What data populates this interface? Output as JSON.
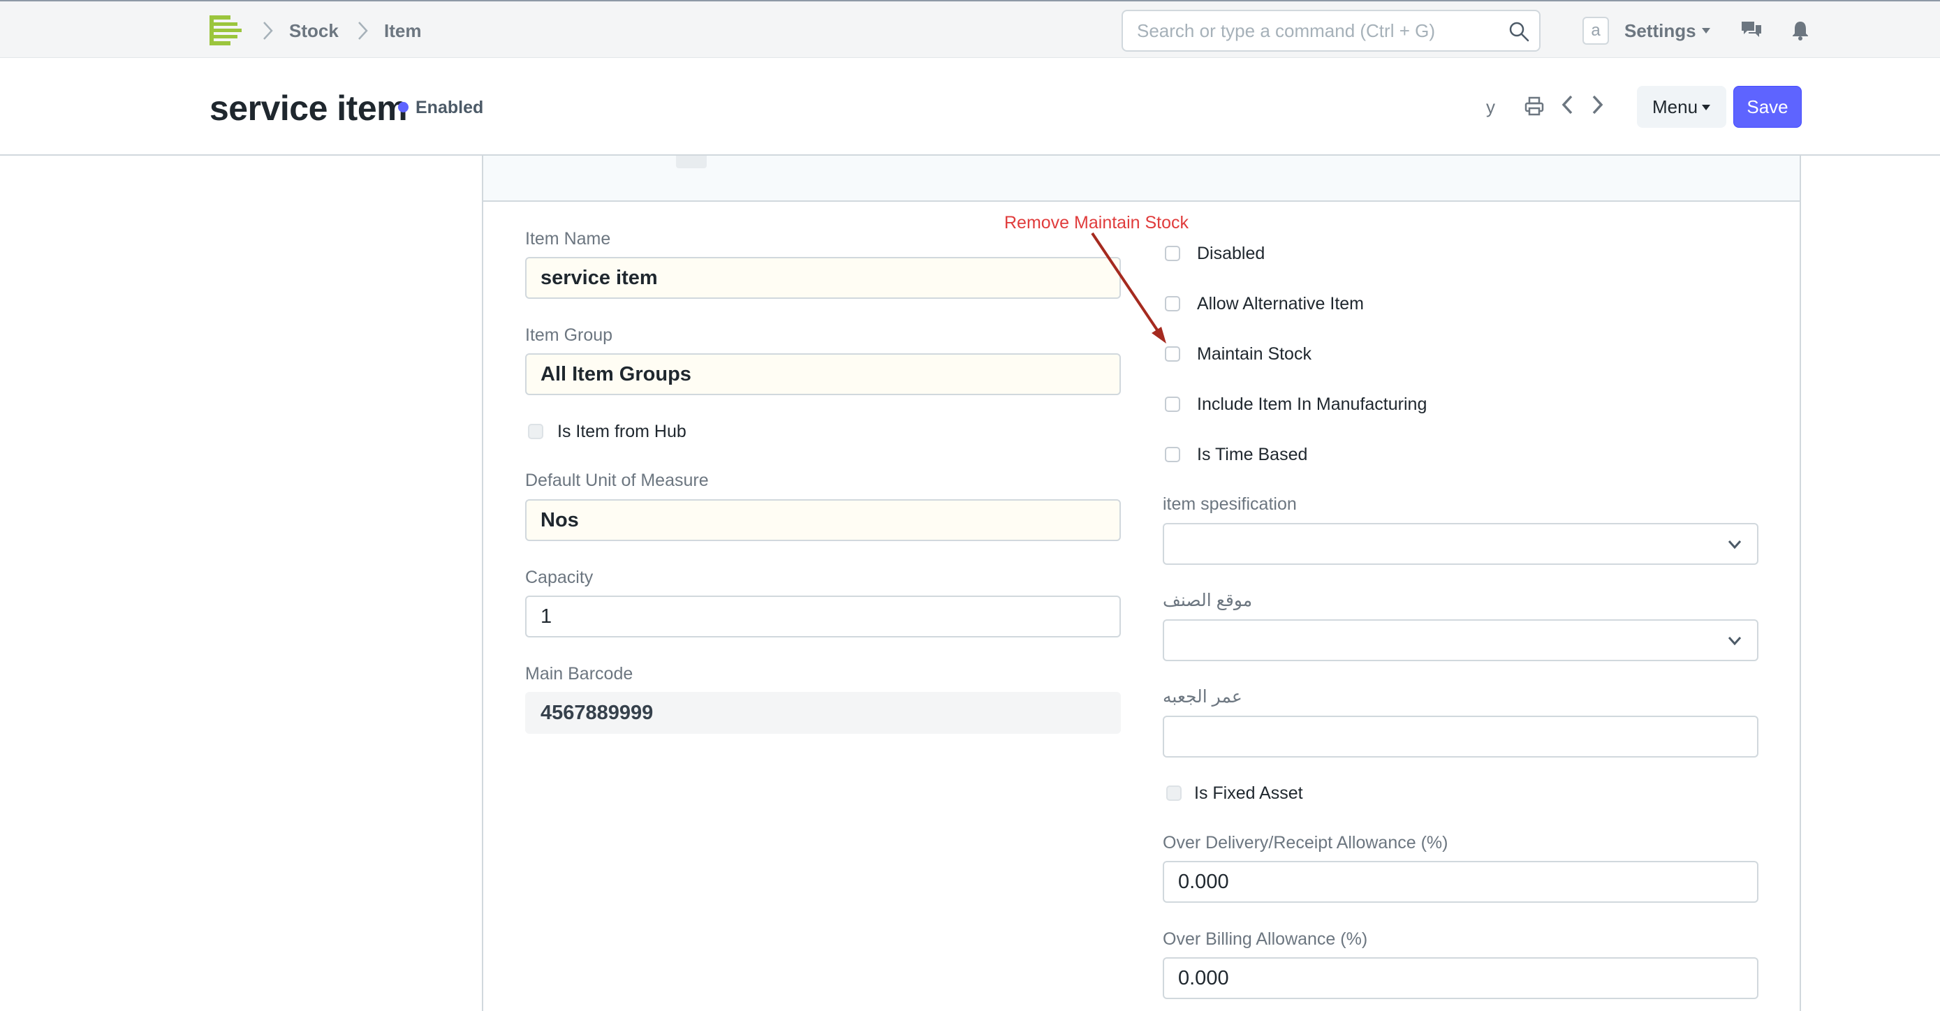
{
  "navbar": {
    "breadcrumbs": [
      "Stock",
      "Item"
    ],
    "search_placeholder": "Search or type a command (Ctrl + G)",
    "avatar_letter": "a",
    "settings_label": "Settings"
  },
  "page_head": {
    "title": "service item",
    "status": "Enabled",
    "extra_text": "y",
    "menu_label": "Menu",
    "save_label": "Save",
    "accent_color": "#5e64ff"
  },
  "annotation": {
    "text": "Remove Maintain Stock",
    "color": "#e03c3c"
  },
  "left_fields": {
    "item_name": {
      "label": "Item Name",
      "value": "service item"
    },
    "item_group": {
      "label": "Item Group",
      "value": "All Item Groups"
    },
    "is_item_from_hub": {
      "label": "Is Item from Hub",
      "checked": false
    },
    "default_uom": {
      "label": "Default Unit of Measure",
      "value": "Nos"
    },
    "capacity": {
      "label": "Capacity",
      "value": "1"
    },
    "main_barcode": {
      "label": "Main Barcode",
      "value": "4567889999"
    }
  },
  "right_checkboxes": [
    {
      "label": "Disabled",
      "checked": false
    },
    {
      "label": "Allow Alternative Item",
      "checked": false
    },
    {
      "label": "Maintain Stock",
      "checked": false
    },
    {
      "label": "Include Item In Manufacturing",
      "checked": false
    },
    {
      "label": "Is Time Based",
      "checked": false
    }
  ],
  "right_fields": {
    "item_specification": {
      "label": "item spesification",
      "value": ""
    },
    "item_location": {
      "label": "موقع الصنف",
      "value": ""
    },
    "shelf_life": {
      "label": "عمر الجعبه",
      "value": ""
    },
    "is_fixed_asset": {
      "label": "Is Fixed Asset",
      "checked": false
    },
    "over_delivery": {
      "label": "Over Delivery/Receipt Allowance (%)",
      "value": "0.000"
    },
    "over_billing": {
      "label": "Over Billing Allowance (%)",
      "value": "0.000"
    }
  }
}
